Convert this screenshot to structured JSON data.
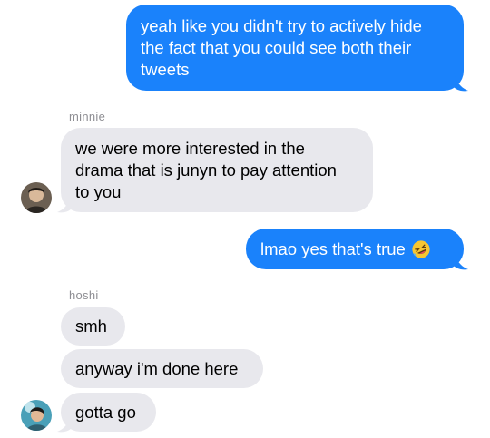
{
  "conversation": {
    "messages": [
      {
        "from": "me",
        "lines": [
          "yeah like you didn't try to actively hide",
          "the fact that you could see both their",
          "tweets"
        ]
      },
      {
        "from": "minnie",
        "sender_label": "minnie",
        "lines": [
          "we were more interested in the",
          "drama that is junyn to pay attention",
          "to you"
        ]
      },
      {
        "from": "me",
        "text": "lmao yes that's true",
        "emoji": "rolling-on-floor-laughing-emoji"
      },
      {
        "from": "hoshi",
        "sender_label": "hoshi",
        "text": "smh"
      },
      {
        "from": "hoshi",
        "text": "anyway i'm done here"
      },
      {
        "from": "hoshi",
        "text": "gotta go"
      }
    ]
  },
  "colors": {
    "outgoing_bubble": "#1a82fb",
    "incoming_bubble": "#e8e8ed",
    "sender_label": "#8e8e93"
  }
}
